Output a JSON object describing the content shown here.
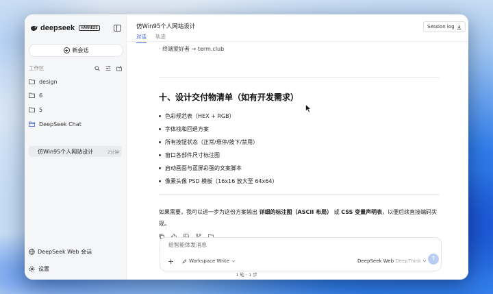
{
  "app": {
    "brand": "deepseek",
    "badge": "HARNESS",
    "title": "仿Win95个人网站设计"
  },
  "sidebar": {
    "new_chat": "新会话",
    "workspace_label": "工作区",
    "folders": [
      {
        "label": "design"
      },
      {
        "label": "6"
      },
      {
        "label": "5"
      },
      {
        "label": "DeepSeek Chat"
      }
    ],
    "active_chat": {
      "label": "仿Win95个人网站设计",
      "time": "2分钟"
    },
    "web_chat": "DeepSeek Web 会话",
    "settings": "设置"
  },
  "tabs": [
    {
      "label": "对话",
      "active": true
    },
    {
      "label": "轨迹",
      "active": false
    }
  ],
  "session_log": "Session log",
  "content": {
    "top_line": "· 终端爱好者 → term.club",
    "heading": "十、设计交付物清单（如有开发需求）",
    "bullets": [
      "色彩规范表（HEX + RGB）",
      "字体栈和回退方案",
      "所有按钮状态（正常/悬停/按下/禁用）",
      "窗口各部件尺寸标注图",
      "启动画面与蓝屏彩蛋的文案脚本",
      "像素头像 PSD 模板（16x16 放大至 64x64）"
    ],
    "para_1": "如果需要，我可以进一步为这份方案输出 ",
    "para_bold_1": "详细的标注图（ASCII 布局）",
    "para_2": " 或 ",
    "para_bold_2": "CSS 变量声明表",
    "para_3": "，以便后续直接编码实现。"
  },
  "composer": {
    "placeholder": "给智能体发消息",
    "workspace_mode": "Workspace Write",
    "model": "DeepSeek Web",
    "think": "DeepThink"
  },
  "footer": "1 轮 · 1 步",
  "colors": {
    "accent": "#3a5bd9",
    "send_button": "#b9cdf4"
  }
}
